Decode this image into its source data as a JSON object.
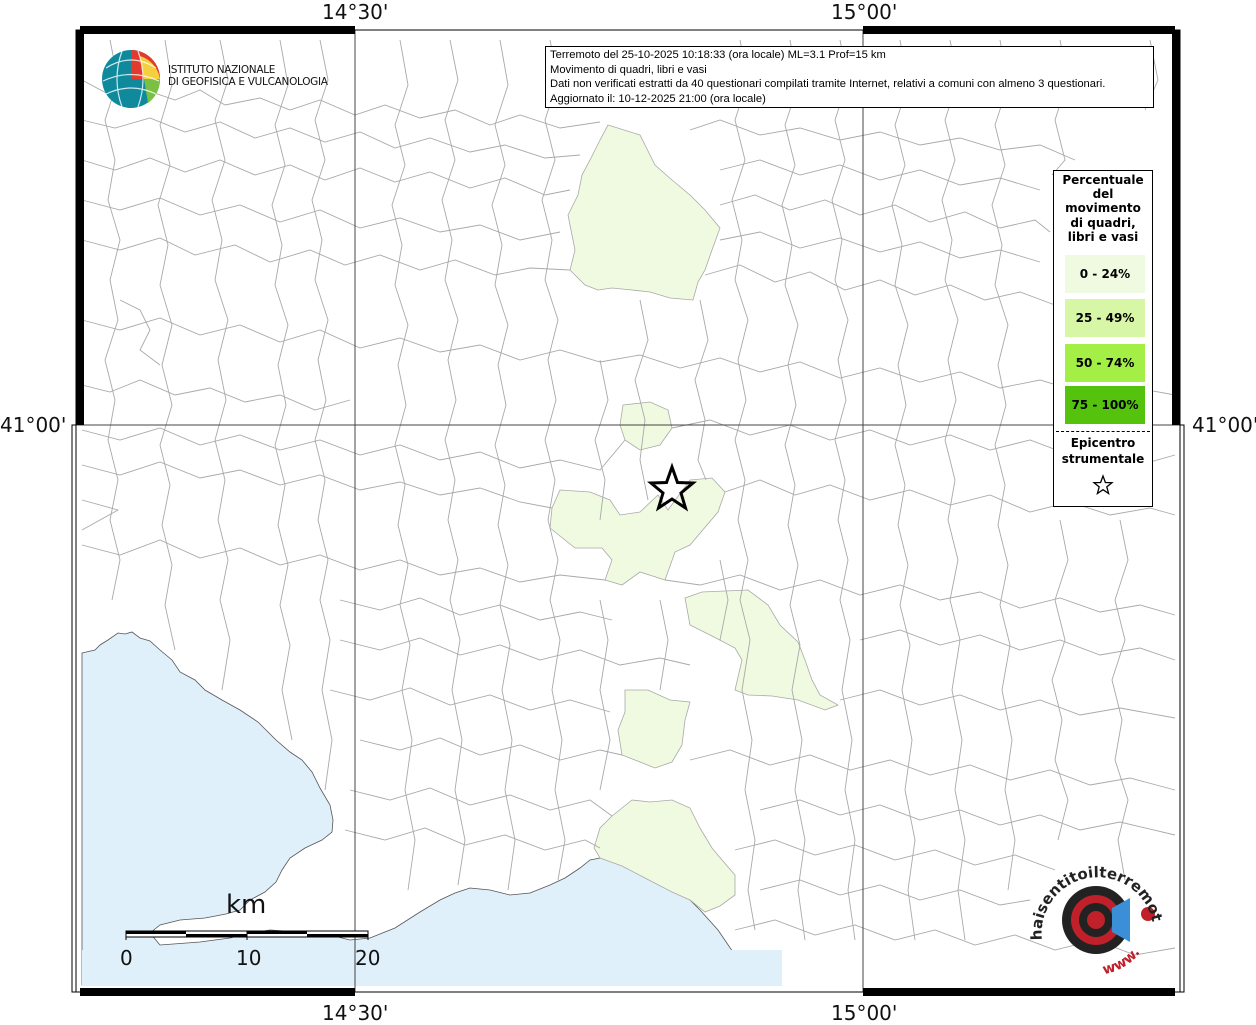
{
  "header": {
    "line1": "Terremoto del 25-10-2025 10:18:33 (ora locale) ML=3.1 Prof=15 km",
    "line2": "Movimento di quadri, libri e vasi",
    "line3": "Dati non verificati estratti da 40 questionari compilati tramite Internet, relativi a comuni con almeno 3 questionari.",
    "line4": "Aggiornato il: 10-12-2025 21:00 (ora locale)"
  },
  "axis_labels": {
    "top_left_lon": "14°30'",
    "top_right_lon": "15°00'",
    "bottom_left_lon": "14°30'",
    "bottom_right_lon": "15°00'",
    "left_lat": "41°00'",
    "right_lat": "41°00'"
  },
  "legend": {
    "title": "Percentuale\ndel\nmovimento\ndi quadri,\nlibri e vasi",
    "classes": [
      {
        "label": "0 - 24%",
        "color": "#f0fae0"
      },
      {
        "label": "25 - 49%",
        "color": "#d8f7a6"
      },
      {
        "label": "50 - 74%",
        "color": "#a4ef45"
      },
      {
        "label": "75 - 100%",
        "color": "#55c30e"
      }
    ],
    "epicenter_label": "Epicentro\nstrumentale"
  },
  "institution": {
    "name": "ISTITUTO NAZIONALE\nDI GEOFISICA E VULCANOLOGIA"
  },
  "scale_bar": {
    "unit": "km",
    "ticks": [
      "0",
      "10",
      "20"
    ]
  },
  "branding": {
    "site": "haisentitoilterremoto.it",
    "www": "www."
  },
  "colors": {
    "sea": "#dff0fb",
    "boundary": "#a9a9a9",
    "grid": "#444444",
    "frame": "#000000",
    "class_0_24": "#f0fae0"
  }
}
